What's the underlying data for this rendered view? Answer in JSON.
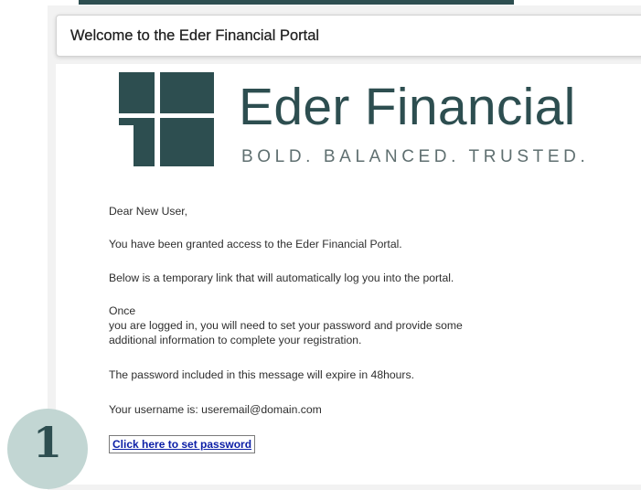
{
  "window": {
    "title": "Welcome to the Eder Financial Portal"
  },
  "brand": {
    "name": "Eder Financial",
    "tagline": "BOLD. BALANCED. TRUSTED.",
    "logo_icon": "eder-financial-logo-icon",
    "color": "#2d4e50"
  },
  "email": {
    "greeting": "Dear New User,",
    "access_line": "You have been granted access to the Eder Financial Portal.",
    "link_intro": "Below is a temporary link that will automatically log you into the portal.",
    "once_line": "Once",
    "instructions_line_1": "you are logged in, you will need to set your password and provide some",
    "instructions_line_2": "additional information to complete your registration.",
    "expiry_line": "The password included in this message will expire in 48hours.",
    "username_line": "Your username is:  useremail@domain.com",
    "link_label": "Click here to set password",
    "link_color": "#0b1ea6"
  },
  "step_badge": {
    "number": "1",
    "color": "#c2d6d3"
  }
}
